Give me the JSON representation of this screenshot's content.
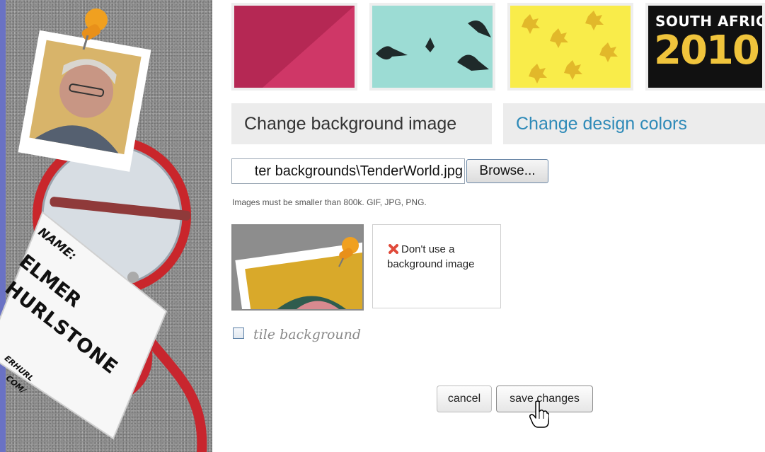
{
  "badge": {
    "name_label": "NAME:",
    "first_name": "ELMER",
    "last_name": "HURLSTONE",
    "web_line1": "ERHURL",
    "web_line2": "COM/"
  },
  "thumbnails": [
    {
      "name": "crimson-diagonal",
      "colors": [
        "#b52854",
        "#cf3767"
      ]
    },
    {
      "name": "birds-on-aqua",
      "colors": [
        "#9cdcd4",
        "#1f2a2a"
      ]
    },
    {
      "name": "yellow-leaves",
      "colors": [
        "#f9ec4a",
        "#e2b82a"
      ]
    },
    {
      "name": "south-africa-2010",
      "top_text": "SOUTH AFRICA",
      "year_text": "2010",
      "colors": [
        "#111111",
        "#f0c43c"
      ]
    }
  ],
  "tabs": {
    "background": "Change background image",
    "colors": "Change design colors"
  },
  "file": {
    "path_value": "ter backgrounds\\TenderWorld.jpg",
    "browse_label": "Browse..."
  },
  "hint": "Images must be smaller than 800k. GIF, JPG, PNG.",
  "no_image": {
    "label": "Don't use a background image",
    "icon": "red-x-icon"
  },
  "tile": {
    "label": "tile background",
    "checked": false
  },
  "actions": {
    "cancel": "cancel",
    "save": "save changes"
  },
  "colors": {
    "link": "#2e8ab8",
    "tab_bg": "#ececec",
    "thumb_border": "#eeeeee"
  }
}
